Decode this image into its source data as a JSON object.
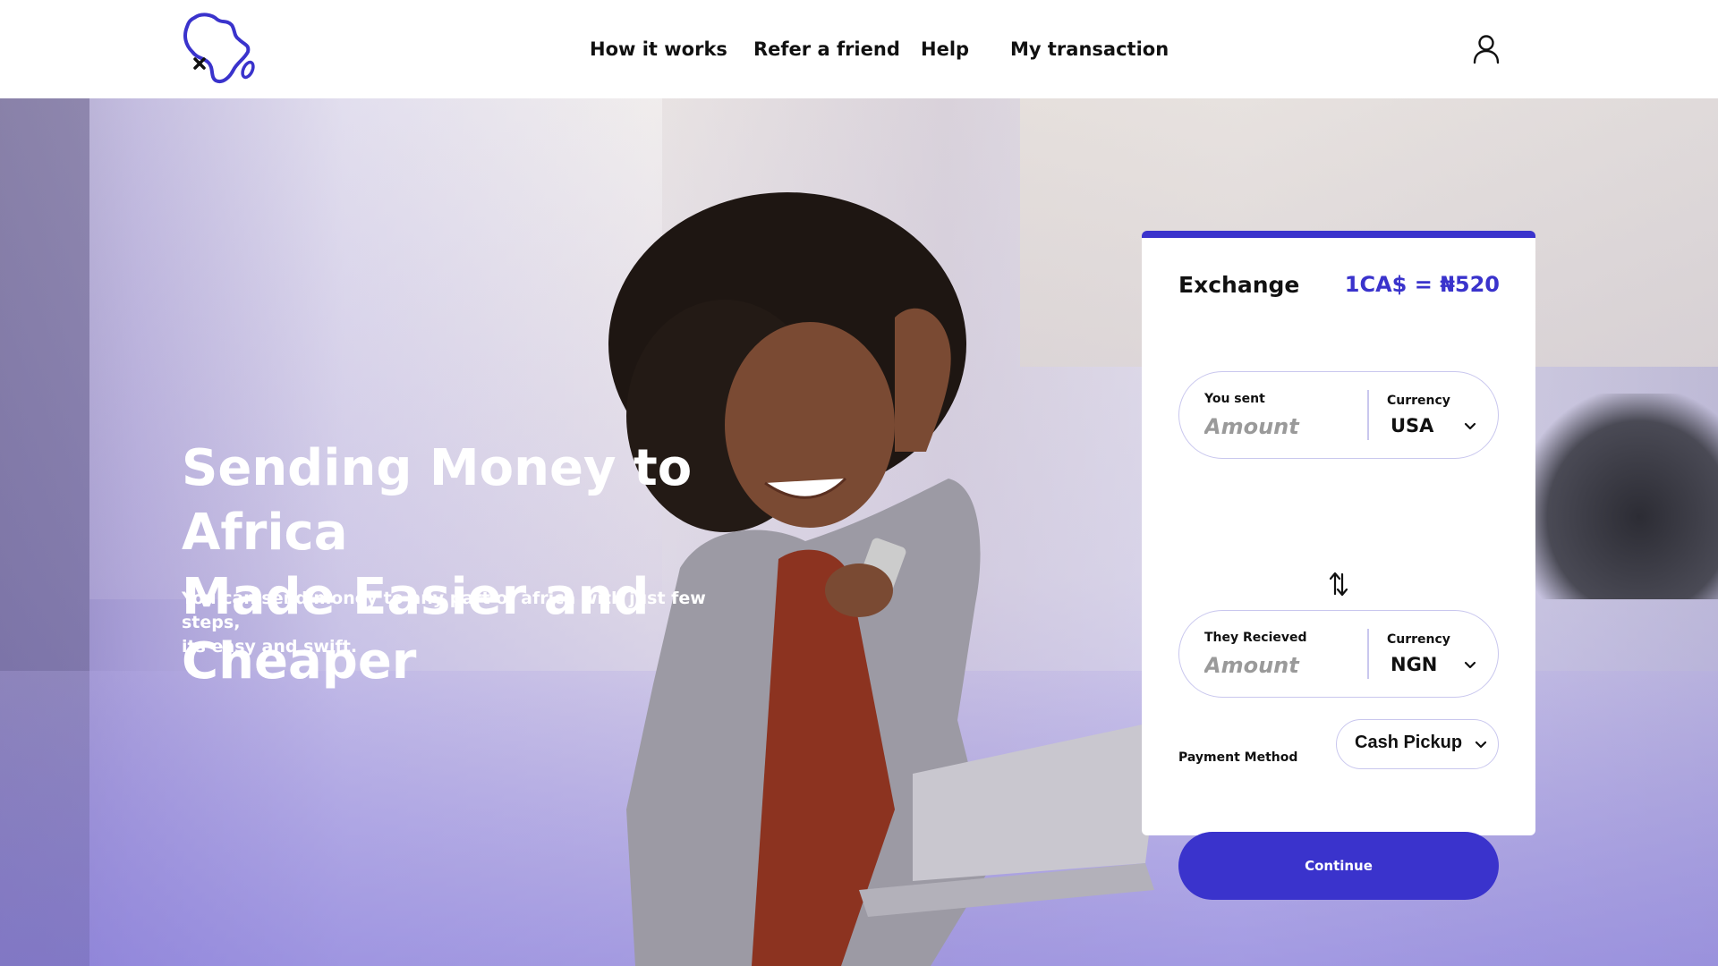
{
  "brand": {
    "accent": "#3a33cc"
  },
  "header": {
    "nav": [
      {
        "label": "How it works"
      },
      {
        "label": "Refer a friend"
      },
      {
        "label": "Help"
      },
      {
        "label": "My transaction"
      }
    ],
    "user_icon": "user-icon"
  },
  "hero": {
    "title_line1": "Sending Money to Africa",
    "title_line2": "Made Easier and Cheaper",
    "subtitle_line1": "You can send money to any part of africa with just few steps,",
    "subtitle_line2": "its easy and swift."
  },
  "exchange": {
    "title": "Exchange",
    "rate": "1CA$ = ₦520",
    "sent": {
      "label": "You sent",
      "placeholder": "Amount",
      "currency_label": "Currency",
      "currency": "USA"
    },
    "swap_icon": "swap-vertical-icon",
    "received": {
      "label": "They Recieved",
      "placeholder": "Amount",
      "currency_label": "Currency",
      "currency": "NGN"
    },
    "payment_method": {
      "label": "Payment Method",
      "value": "Cash Pickup"
    },
    "continue_label": "Continue"
  }
}
